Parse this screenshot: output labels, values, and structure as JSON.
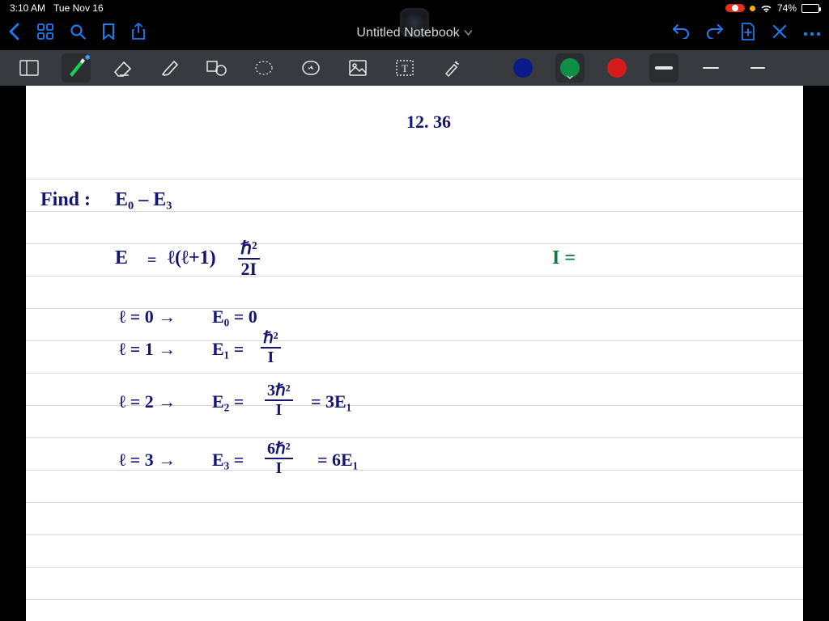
{
  "status": {
    "time": "3:10 AM",
    "date": "Tue Nov 16",
    "battery_pct": "74%"
  },
  "nav": {
    "title": "Untitled Notebook"
  },
  "colors": {
    "c1": "#0b1c8a",
    "c2": "#0f8f46",
    "c3": "#d41c1c"
  },
  "notes": {
    "header": "12. 36",
    "find_label": "Find :",
    "find_expr": "E₀ – E₃",
    "energy_lhs": "E",
    "energy_eq": "=",
    "energy_coef": "ℓ(ℓ+1)",
    "energy_num": "ℏ²",
    "energy_den": "2I",
    "moment": "I =",
    "l0": "ℓ = 0 →",
    "l0r": "E₀ = 0",
    "l1": "ℓ = 1 →",
    "l1r_lhs": "E₁ =",
    "l1r_num": "ℏ²",
    "l1r_den": "I",
    "l2": "ℓ = 2 →",
    "l2r_lhs": "E₂ =",
    "l2r_num": "3ℏ²",
    "l2r_den": "I",
    "l2r_tail": "= 3E₁",
    "l3": "ℓ = 3 →",
    "l3r_lhs": "E₃ =",
    "l3r_num": "6ℏ²",
    "l3r_den": "I",
    "l3r_tail": "= 6E₁"
  }
}
